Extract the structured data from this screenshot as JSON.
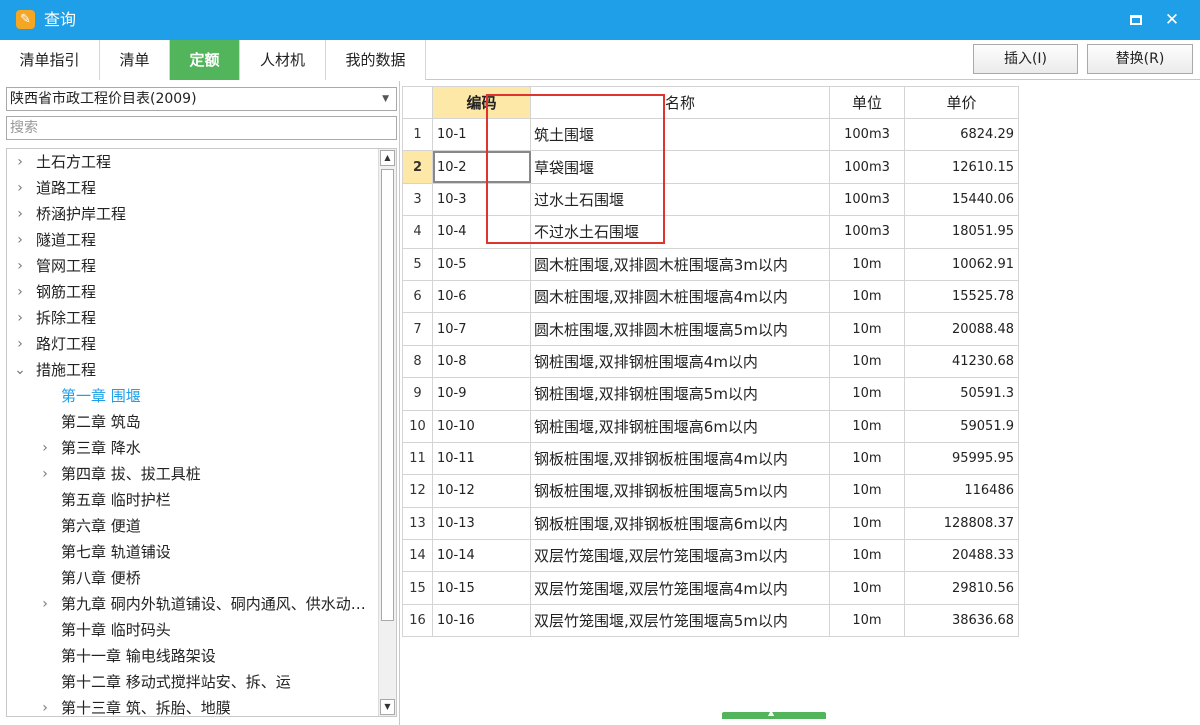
{
  "window": {
    "title": "查询",
    "icon": "app-logo-icon",
    "accent": "#1e9fe8"
  },
  "tabs": [
    {
      "label": "清单指引",
      "active": false
    },
    {
      "label": "清单",
      "active": false
    },
    {
      "label": "定额",
      "active": true
    },
    {
      "label": "人材机",
      "active": false
    },
    {
      "label": "我的数据",
      "active": false
    }
  ],
  "toolbar": {
    "insert_label": "插入(I)",
    "replace_label": "替换(R)"
  },
  "library": {
    "selected": "陕西省市政工程价目表(2009)",
    "search_placeholder": "搜索"
  },
  "tree": [
    {
      "label": "土石方工程",
      "level": 0,
      "arrow": "›"
    },
    {
      "label": "道路工程",
      "level": 0,
      "arrow": "›"
    },
    {
      "label": "桥涵护岸工程",
      "level": 0,
      "arrow": "›"
    },
    {
      "label": "隧道工程",
      "level": 0,
      "arrow": "›"
    },
    {
      "label": "管网工程",
      "level": 0,
      "arrow": "›"
    },
    {
      "label": "钢筋工程",
      "level": 0,
      "arrow": "›"
    },
    {
      "label": "拆除工程",
      "level": 0,
      "arrow": "›"
    },
    {
      "label": "路灯工程",
      "level": 0,
      "arrow": "›"
    },
    {
      "label": "措施工程",
      "level": 0,
      "arrow": "⌄"
    },
    {
      "label": "第一章 围堰",
      "level": 1,
      "arrow": "",
      "selected": true
    },
    {
      "label": "第二章 筑岛",
      "level": 1,
      "arrow": ""
    },
    {
      "label": "第三章 降水",
      "level": 1,
      "arrow": "›"
    },
    {
      "label": "第四章 拔、拔工具桩",
      "level": 1,
      "arrow": "›"
    },
    {
      "label": "第五章 临时护栏",
      "level": 1,
      "arrow": ""
    },
    {
      "label": "第六章 便道",
      "level": 1,
      "arrow": ""
    },
    {
      "label": "第七章 轨道铺设",
      "level": 1,
      "arrow": ""
    },
    {
      "label": "第八章 便桥",
      "level": 1,
      "arrow": ""
    },
    {
      "label": "第九章 硐内外轨道铺设、硐内通风、供水动…",
      "level": 1,
      "arrow": "›"
    },
    {
      "label": "第十章 临时码头",
      "level": 1,
      "arrow": ""
    },
    {
      "label": "第十一章 输电线路架设",
      "level": 1,
      "arrow": ""
    },
    {
      "label": "第十二章 移动式搅拌站安、拆、运",
      "level": 1,
      "arrow": ""
    },
    {
      "label": "第十三章 筑、拆胎、地膜",
      "level": 1,
      "arrow": "›"
    }
  ],
  "table": {
    "headers": {
      "code": "编码",
      "name": "名称",
      "unit": "单位",
      "price": "单价"
    },
    "current_row": 2,
    "rows": [
      {
        "n": "1",
        "code": "10-1",
        "name": "筑土围堰",
        "unit": "100m3",
        "price": "6824.29"
      },
      {
        "n": "2",
        "code": "10-2",
        "name": "草袋围堰",
        "unit": "100m3",
        "price": "12610.15"
      },
      {
        "n": "3",
        "code": "10-3",
        "name": "过水土石围堰",
        "unit": "100m3",
        "price": "15440.06"
      },
      {
        "n": "4",
        "code": "10-4",
        "name": "不过水土石围堰",
        "unit": "100m3",
        "price": "18051.95"
      },
      {
        "n": "5",
        "code": "10-5",
        "name": "圆木桩围堰,双排圆木桩围堰高3m以内",
        "unit": "10m",
        "price": "10062.91"
      },
      {
        "n": "6",
        "code": "10-6",
        "name": "圆木桩围堰,双排圆木桩围堰高4m以内",
        "unit": "10m",
        "price": "15525.78"
      },
      {
        "n": "7",
        "code": "10-7",
        "name": "圆木桩围堰,双排圆木桩围堰高5m以内",
        "unit": "10m",
        "price": "20088.48"
      },
      {
        "n": "8",
        "code": "10-8",
        "name": "钢桩围堰,双排钢桩围堰高4m以内",
        "unit": "10m",
        "price": "41230.68"
      },
      {
        "n": "9",
        "code": "10-9",
        "name": "钢桩围堰,双排钢桩围堰高5m以内",
        "unit": "10m",
        "price": "50591.3"
      },
      {
        "n": "10",
        "code": "10-10",
        "name": "钢桩围堰,双排钢桩围堰高6m以内",
        "unit": "10m",
        "price": "59051.9"
      },
      {
        "n": "11",
        "code": "10-11",
        "name": "钢板桩围堰,双排钢板桩围堰高4m以内",
        "unit": "10m",
        "price": "95995.95"
      },
      {
        "n": "12",
        "code": "10-12",
        "name": "钢板桩围堰,双排钢板桩围堰高5m以内",
        "unit": "10m",
        "price": "116486"
      },
      {
        "n": "13",
        "code": "10-13",
        "name": "钢板桩围堰,双排钢板桩围堰高6m以内",
        "unit": "10m",
        "price": "128808.37"
      },
      {
        "n": "14",
        "code": "10-14",
        "name": "双层竹笼围堰,双层竹笼围堰高3m以内",
        "unit": "10m",
        "price": "20488.33"
      },
      {
        "n": "15",
        "code": "10-15",
        "name": "双层竹笼围堰,双层竹笼围堰高4m以内",
        "unit": "10m",
        "price": "29810.56"
      },
      {
        "n": "16",
        "code": "10-16",
        "name": "双层竹笼围堰,双层竹笼围堰高5m以内",
        "unit": "10m",
        "price": "38636.68"
      }
    ]
  },
  "colors": {
    "tab_active": "#52b45b",
    "header_highlight": "#fde8a8",
    "selected_tree_text": "#1e9fe8",
    "annotation_box": "#e0322e"
  }
}
